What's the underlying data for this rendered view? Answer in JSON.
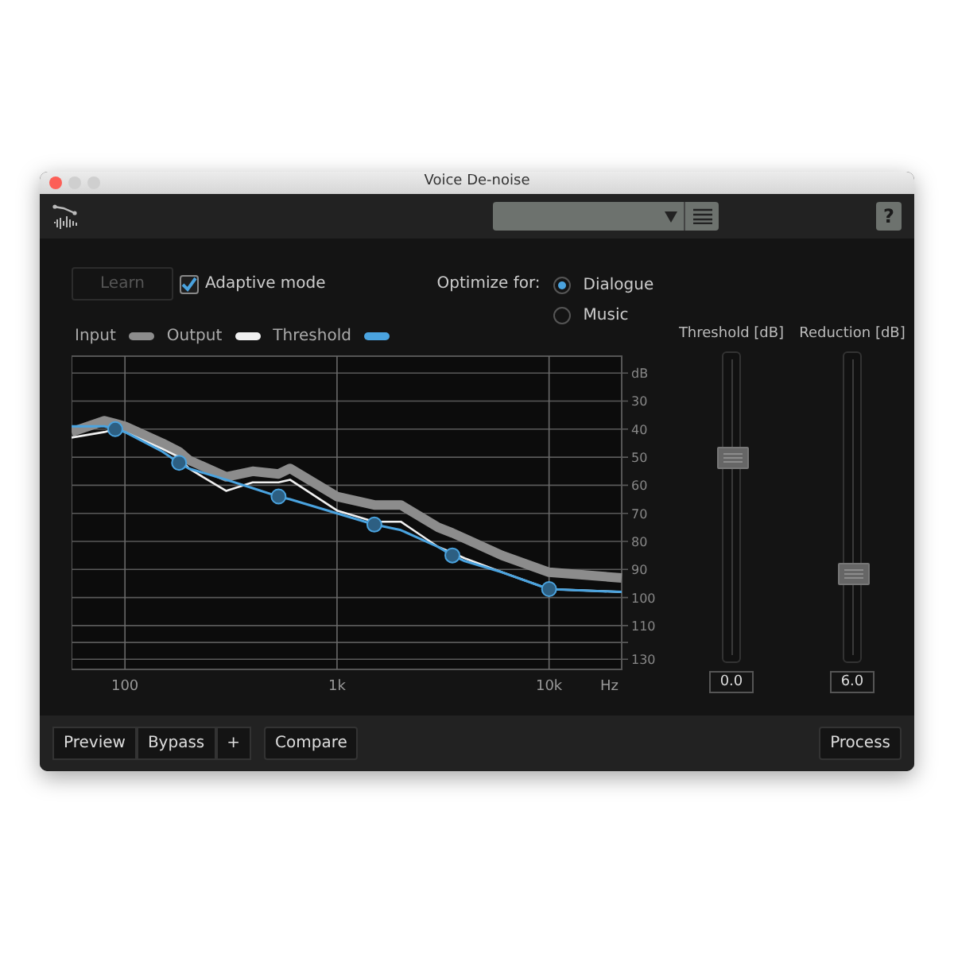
{
  "window": {
    "title": "Voice De-noise"
  },
  "toolbar": {
    "help": "?"
  },
  "controls": {
    "learn": {
      "label": "Learn",
      "disabled": true
    },
    "adaptive_mode": {
      "label": "Adaptive mode",
      "checked": true
    },
    "optimize_label": "Optimize for:",
    "optimize_options": [
      {
        "label": "Dialogue",
        "selected": true
      },
      {
        "label": "Music",
        "selected": false
      }
    ]
  },
  "spectrum": {
    "legend": [
      {
        "name": "Input",
        "color": "#8c8c8c"
      },
      {
        "name": "Output",
        "color": "#f0f0f0"
      },
      {
        "name": "Threshold",
        "color": "#4aa3df"
      }
    ],
    "y_unit": "dB",
    "y_labels": [
      "30",
      "40",
      "50",
      "60",
      "70",
      "80",
      "90",
      "100",
      "110",
      "130"
    ],
    "x_labels": [
      "100",
      "1k",
      "10k"
    ],
    "x_unit": "Hz"
  },
  "sliders": [
    {
      "label": "Threshold [dB]",
      "level": 0.66,
      "value": "0.0"
    },
    {
      "label": "Reduction [dB]",
      "level": 0.26,
      "value": "6.0"
    }
  ],
  "footer": {
    "buttons": [
      {
        "label": "Preview"
      },
      {
        "label": "Bypass"
      },
      {
        "label": "+"
      },
      {
        "label": "Compare"
      }
    ],
    "process": "Process"
  }
}
